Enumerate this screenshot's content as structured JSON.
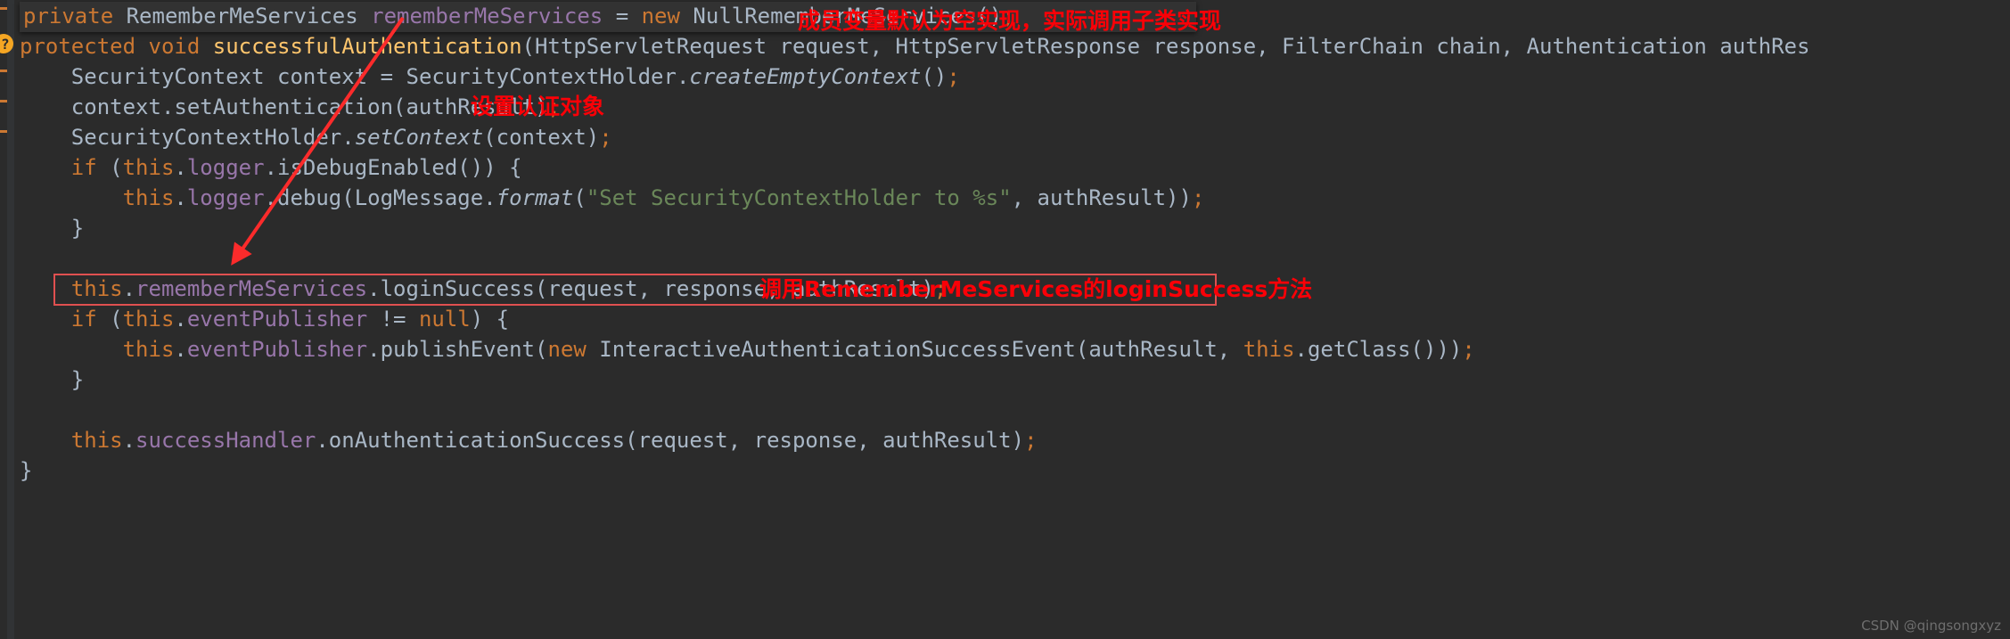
{
  "editor": {
    "background_color": "#2b2b2b",
    "sticky_header_color": "#323232",
    "default_text_color": "#a9b7c6",
    "annotation_color": "#fb0007",
    "highlight_box_color": "#e05050"
  },
  "code": {
    "sticky_line": {
      "text": "private RememberMeServices rememberMeServices = new NullRememberMeServices();"
    },
    "lines": [
      {
        "text": "protected void successfulAuthentication(HttpServletRequest request, HttpServletResponse response, FilterChain chain, Authentication authRes"
      },
      {
        "text": "    SecurityContext context = SecurityContextHolder.createEmptyContext();"
      },
      {
        "text": "    context.setAuthentication(authResult);"
      },
      {
        "text": "    SecurityContextHolder.setContext(context);"
      },
      {
        "text": "    if (this.logger.isDebugEnabled()) {"
      },
      {
        "text": "        this.logger.debug(LogMessage.format(\"Set SecurityContextHolder to %s\", authResult));"
      },
      {
        "text": "    }"
      },
      {
        "text": ""
      },
      {
        "text": "    this.rememberMeServices.loginSuccess(request, response, authResult);"
      },
      {
        "text": "    if (this.eventPublisher != null) {"
      },
      {
        "text": "        this.eventPublisher.publishEvent(new InteractiveAuthenticationSuccessEvent(authResult, this.getClass()));"
      },
      {
        "text": "    }"
      },
      {
        "text": ""
      },
      {
        "text": "    this.successHandler.onAuthenticationSuccess(request, response, authResult);"
      },
      {
        "text": "}"
      }
    ]
  },
  "annotations": [
    {
      "id": "annot-member-variable",
      "text": "成员变量默认为空实现，实际调用子类实现"
    },
    {
      "id": "annot-set-auth-object",
      "text": "设置认证对象"
    },
    {
      "id": "annot-call-remembermeservices",
      "text": "调用RememberMeServices的loginSuccess方法"
    }
  ],
  "watermark": {
    "text": "CSDN @qingsongxyz"
  },
  "gutter": {
    "bulb_label": "?"
  }
}
